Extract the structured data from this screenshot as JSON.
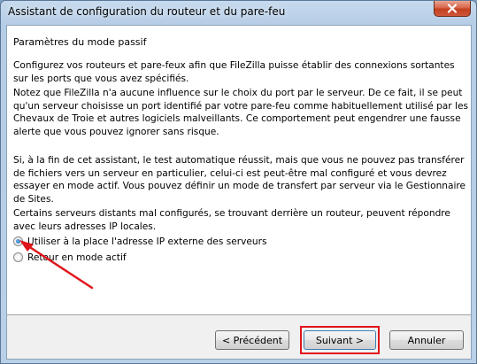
{
  "window": {
    "title": "Assistant de configuration du routeur et du pare-feu",
    "close_icon": "close-icon"
  },
  "page": {
    "heading": "Paramètres du mode passif",
    "para1": "Configurez vos routeurs et pare-feux afin que FileZilla puisse établir des connexions sortantes sur les ports que vous avez spécifiés.",
    "para2": "Notez que FileZilla n'a aucune influence sur le choix du port par le serveur. De ce fait, il se peut qu'un serveur choisisse un port identifié par votre pare-feu comme habituellement utilisé par les Chevaux de Troie et autres logiciels malveillants. Ce comportement peut engendrer une fausse alerte que vous pouvez ignorer sans risque.",
    "para3": "Si, à la fin de cet assistant, le test automatique réussit, mais que vous ne pouvez pas transférer de fichiers vers un serveur en particulier, celui-ci est peut-être mal configuré et vous devrez essayer en mode actif. Vous pouvez définir un mode de transfert par serveur via le Gestionnaire de Sites.",
    "para4": "Certains serveurs distants mal configurés, se trouvant derrière un routeur, peuvent répondre avec leurs adresses IP locales."
  },
  "options": [
    {
      "label": "Utiliser à la place l'adresse IP externe des serveurs",
      "checked": true
    },
    {
      "label": "Retour en mode actif",
      "checked": false
    }
  ],
  "buttons": {
    "prev": "< Précédent",
    "next": "Suivant >",
    "cancel": "Annuler"
  },
  "annotation_color": "#e0141b"
}
